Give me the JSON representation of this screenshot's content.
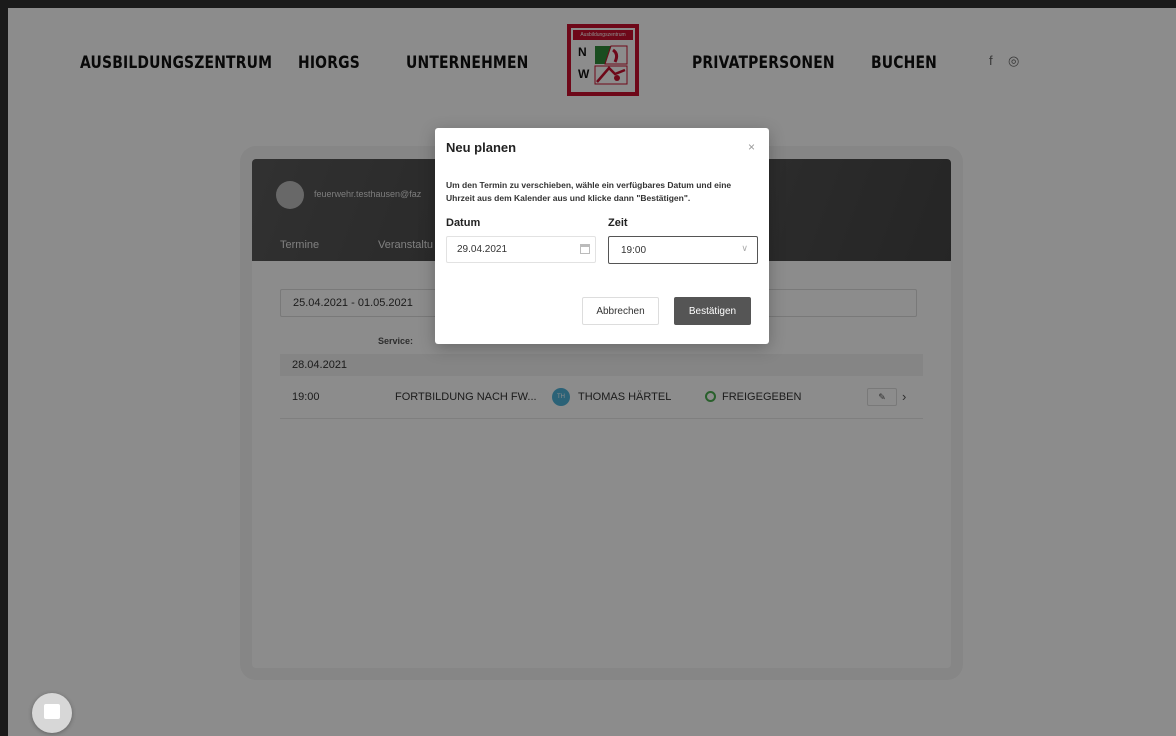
{
  "nav": {
    "items": [
      "AUSBILDUNGSZENTRUM",
      "HIORGS",
      "UNTERNEHMEN",
      "PRIVATPERSONEN",
      "BUCHEN"
    ],
    "logo": {
      "banner": "Ausbildungszentrum",
      "letter_top": "N",
      "letter_bottom": "W"
    },
    "social": {
      "facebook": "f",
      "instagram": "◎"
    }
  },
  "profile": {
    "email": "feuerwehr.testhausen@faz",
    "tabs": [
      "Termine",
      "Veranstaltu"
    ]
  },
  "filter": {
    "date_range": "25.04.2021 - 01.05.2021",
    "service_label": "Service:"
  },
  "appointments": {
    "date_header": "28.04.2021",
    "rows": [
      {
        "time": "19:00",
        "service": "FORTBILDUNG NACH FW...",
        "person_initials": "TH",
        "person": "THOMAS HÄRTEL",
        "status": "FREIGEGEBEN",
        "status_color": "#4caf50",
        "edit_icon": "✎",
        "chevron": "›"
      }
    ]
  },
  "dialog": {
    "title": "Neu planen",
    "close": "×",
    "description": "Um den Termin zu verschieben, wähle ein verfügbares Datum und eine Uhrzeit aus dem Kalender aus und klicke dann \"Bestätigen\".",
    "date_label": "Datum",
    "date_value": "29.04.2021",
    "time_label": "Zeit",
    "time_value": "19:00",
    "time_arrow": "∨",
    "cancel_label": "Abbrechen",
    "confirm_label": "Bestätigen"
  },
  "colors": {
    "overlay": "rgba(0,0,0,0.45)",
    "logo_red": "#c8102e",
    "confirm_bg": "#555555"
  }
}
